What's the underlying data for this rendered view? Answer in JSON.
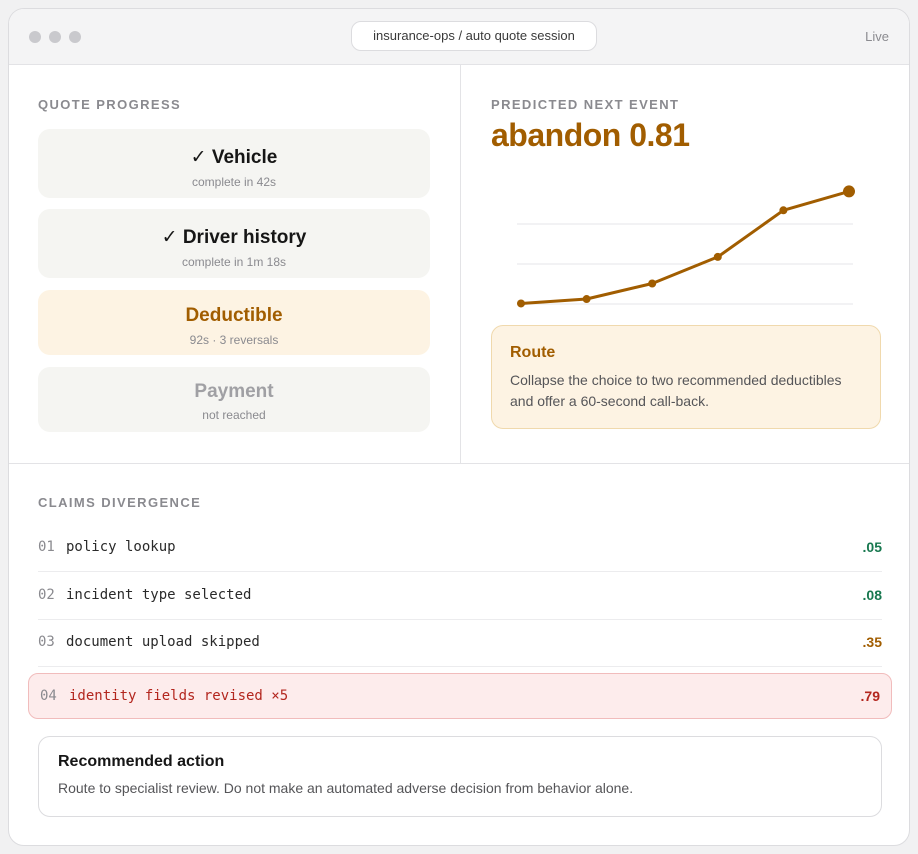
{
  "window": {
    "address": "insurance-ops / auto quote session",
    "status": "Live"
  },
  "quote_progress": {
    "label": "QUOTE PROGRESS",
    "steps": [
      {
        "title": "✓ Vehicle",
        "sub": "complete in 42s",
        "state": "complete"
      },
      {
        "title": "✓ Driver history",
        "sub": "complete in 1m 18s",
        "state": "complete"
      },
      {
        "title": "Deductible",
        "sub": "92s · 3 reversals",
        "state": "current"
      },
      {
        "title": "Payment",
        "sub": "not reached",
        "state": "pending"
      }
    ]
  },
  "prediction": {
    "label": "PREDICTED NEXT EVENT",
    "value": "abandon 0.81",
    "route_title": "Route",
    "route_body": "Collapse the choice to two recommended deductibles and offer a 60-second call-back."
  },
  "chart_data": {
    "type": "line",
    "x": [
      1,
      2,
      3,
      4,
      5,
      6
    ],
    "series": [
      {
        "values": [
          0.05,
          0.09,
          0.23,
          0.47,
          0.89,
          1.06
        ]
      }
    ],
    "ylim": [
      0,
      1.1
    ],
    "grid": true,
    "color": "#a15d00"
  },
  "claims": {
    "label": "CLAIMS DIVERGENCE",
    "rows": [
      {
        "num": "01",
        "label": "policy lookup",
        "score": ".05",
        "level": "low"
      },
      {
        "num": "02",
        "label": "incident type selected",
        "score": ".08",
        "level": "low"
      },
      {
        "num": "03",
        "label": "document upload skipped",
        "score": ".35",
        "level": "mid"
      },
      {
        "num": "04",
        "label": "identity fields revised ×5",
        "score": ".79",
        "level": "high"
      }
    ]
  },
  "recommendation": {
    "title": "Recommended action",
    "body": "Route to specialist review. Do not make an automated adverse decision from behavior alone."
  },
  "colors": {
    "accent": "#a15d00",
    "low": "#18784f",
    "high": "#b3261e"
  }
}
